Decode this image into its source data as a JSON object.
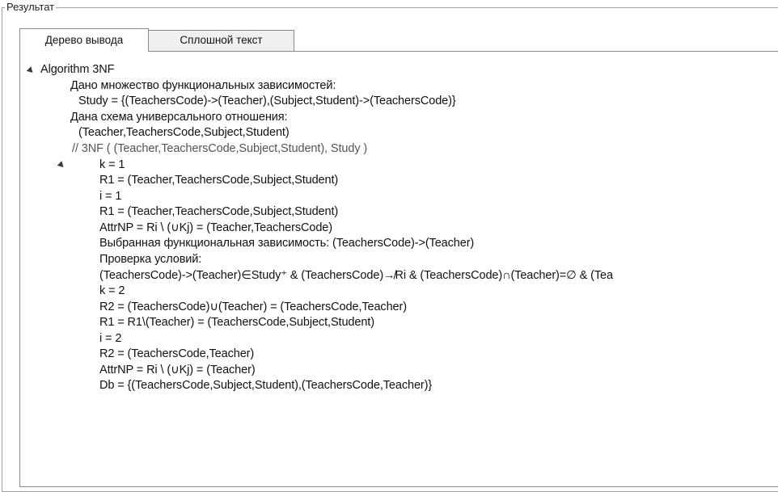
{
  "group": {
    "title": "Результат"
  },
  "tabs": [
    {
      "label": "Дерево вывода",
      "active": true
    },
    {
      "label": "Сплошной текст",
      "active": false
    }
  ],
  "tree": {
    "root": "Algorithm 3NF",
    "lines": [
      "Дано множество функциональных зависимостей:",
      "Study = {(TeachersCode)->(Teacher),(Subject,Student)->(TeachersCode)}",
      "Дана схема универсального отношения:",
      "(Teacher,TeachersCode,Subject,Student)",
      "// 3NF ( (Teacher,TeachersCode,Subject,Student), Study )",
      "k = 1",
      "R1 = (Teacher,TeachersCode,Subject,Student)",
      "i = 1",
      "R1 = (Teacher,TeachersCode,Subject,Student)",
      "AttrNP = Ri \\ (∪Kj) = (Teacher,TeachersCode)",
      "Выбранная функциональная зависимость: (TeachersCode)->(Teacher)",
      "Проверка условий:",
      "(TeachersCode)->(Teacher)∈Study⁺ & (TeachersCode)↛Ri & (TeachersCode)∩(Teacher)=∅ & (Tea",
      "k = 2",
      "R2 = (TeachersCode)∪(Teacher) = (TeachersCode,Teacher)",
      "R1 = R1\\(Teacher) = (TeachersCode,Subject,Student)",
      "i = 2",
      "R2 = (TeachersCode,Teacher)",
      "AttrNP = Ri \\ (∪Kj) = (Teacher)",
      "Db = {(TeachersCode,Subject,Student),(TeachersCode,Teacher)}"
    ]
  }
}
